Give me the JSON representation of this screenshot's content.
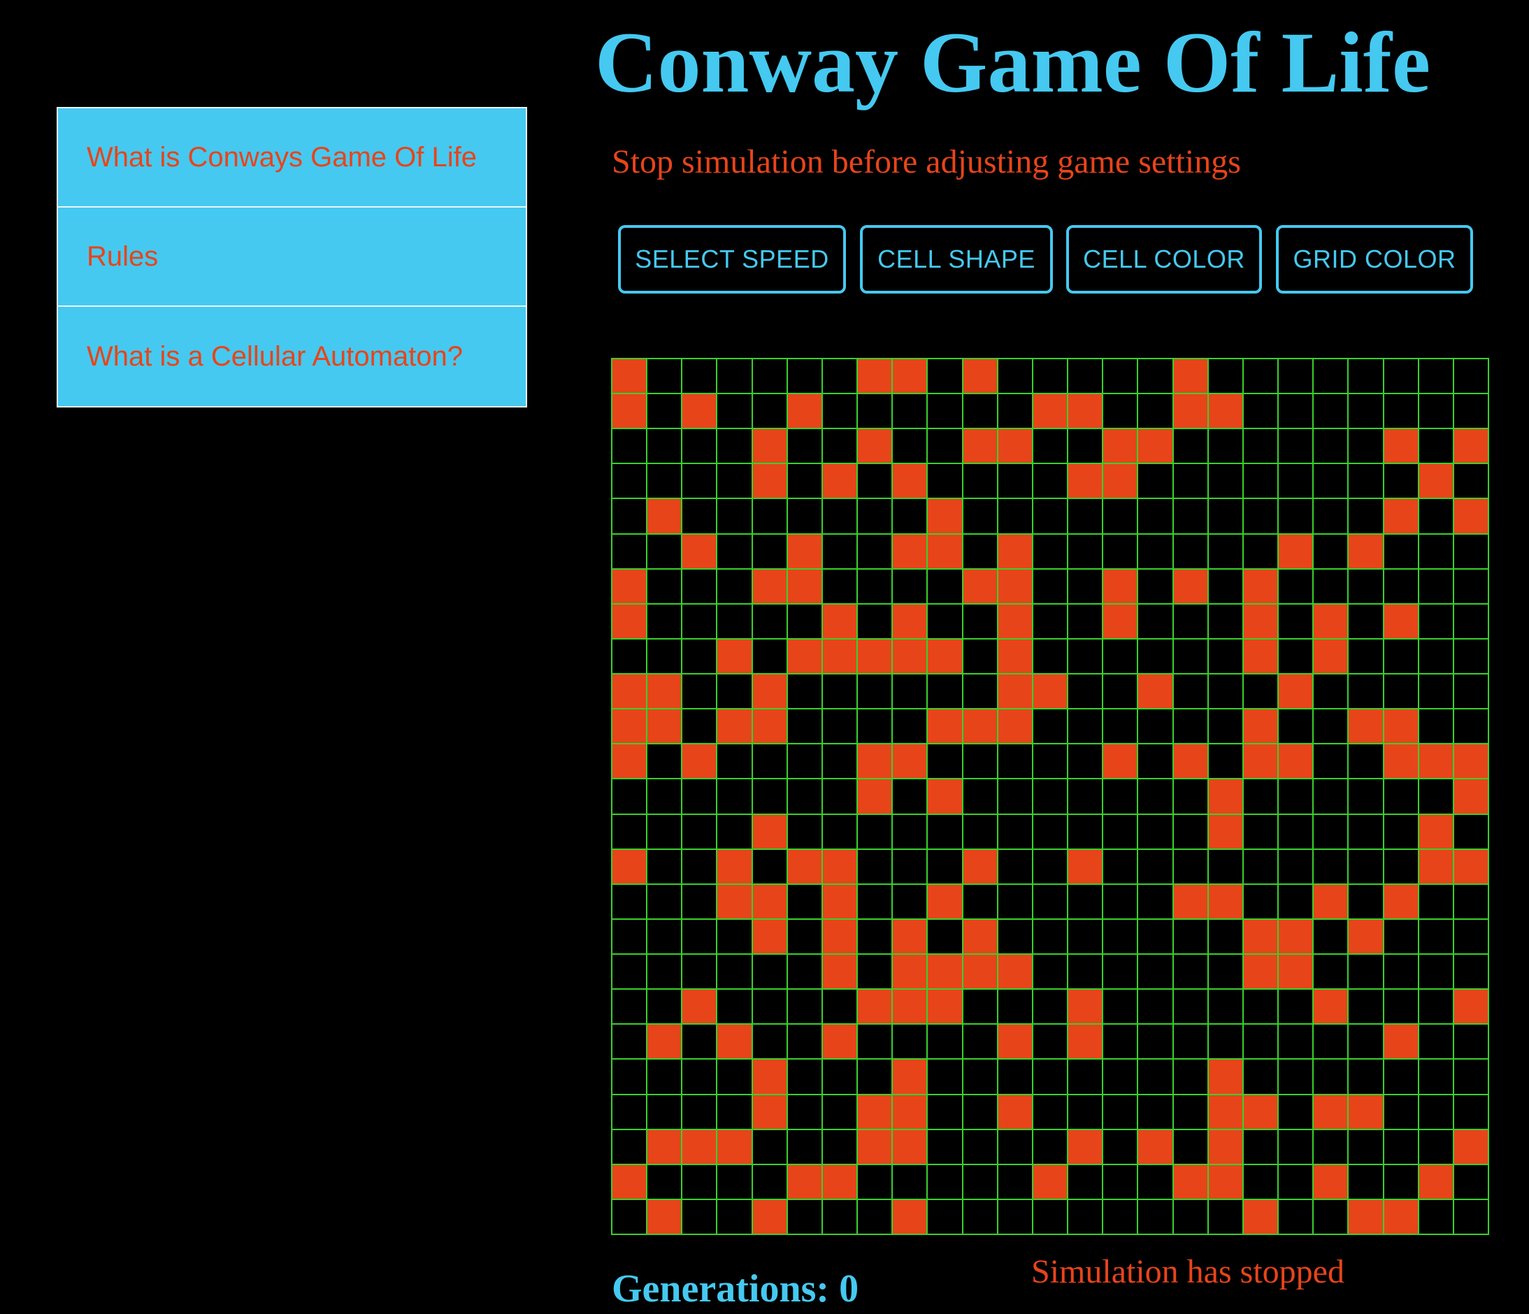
{
  "header": {
    "title": "Conway Game Of Life"
  },
  "sidebar": {
    "items": [
      {
        "label": "What is Conways Game Of Life"
      },
      {
        "label": "Rules"
      },
      {
        "label": "What is a Cellular Automaton?"
      }
    ]
  },
  "notice": {
    "text": "Stop simulation before adjusting game settings"
  },
  "settings": {
    "buttons": [
      {
        "label": "SELECT SPEED"
      },
      {
        "label": "CELL SHAPE"
      },
      {
        "label": "CELL COLOR"
      },
      {
        "label": "GRID COLOR"
      }
    ]
  },
  "colors": {
    "background": "#000000",
    "accent": "#45c9f0",
    "cell_alive": "#e8441a",
    "grid_lines": "#39d12a"
  },
  "grid": {
    "rows": 25,
    "cols": 25,
    "cells": [
      "1000000110100000100000000",
      "1010010000001100110000000",
      "0000100100110011000000101",
      "0000101010000110000000010",
      "0100000001000000000000101",
      "0010010011010000000101000",
      "1000110000110010101000000",
      "1000001010010010001010100",
      "0001011111010000001010000",
      "1100100000011001000100000",
      "1101100001110000001001100",
      "1010000110000010101100111",
      "0000000101000000010000001",
      "0000100000000000010000010",
      "1001011000100100000000011",
      "0001101001000000110010100",
      "0000101010100000001101000",
      "0000001011110000001100000",
      "0010000111000100000010001",
      "0101001000010100000000100",
      "0000100010000000010000000",
      "0000100110010000011011000",
      "0111000110000101010000001",
      "1000011000001000110010010",
      "0100100010000000001001100"
    ]
  },
  "footer": {
    "generations": "Generations: 0",
    "status": "Simulation has stopped"
  }
}
